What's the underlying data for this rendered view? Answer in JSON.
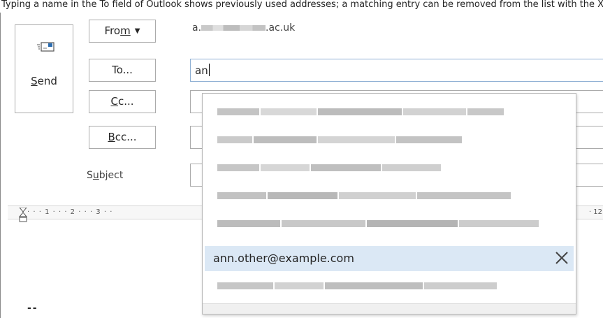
{
  "caption": "Typing a name in the To field of Outlook shows previously used addresses; a matching entry can be removed from the list with the X that appears.",
  "send_button": {
    "label_underlined": "S",
    "label_rest": "end",
    "icon": "envelope-send-icon"
  },
  "from_button": {
    "label_pre": "Fro",
    "label_underlined": "m",
    "caret_icon": "caret-down-icon"
  },
  "to_button": {
    "label": "To..."
  },
  "cc_button": {
    "label_underlined": "C",
    "label_rest": "c..."
  },
  "bcc_button": {
    "label_underlined": "B",
    "label_rest": "cc..."
  },
  "from_account": {
    "prefix": "a.",
    "suffix": ".ac.uk"
  },
  "to_field": {
    "value": "an"
  },
  "subject": {
    "label_pre": "S",
    "label_underlined": "u",
    "label_rest": "bject"
  },
  "ruler": {
    "ticks": "· · · 1 · · · 2 · · · 3 · ·",
    "right_tick": "· 12"
  },
  "body": {
    "signature": "--"
  },
  "autocomplete": {
    "visible_entry": "ann.other@example.com",
    "delete_icon": "close-x-icon",
    "entries": [
      {
        "blurred": true
      },
      {
        "blurred": true
      },
      {
        "blurred": true
      },
      {
        "blurred": true
      },
      {
        "blurred": true
      },
      {
        "blurred": false,
        "text": "ann.other@example.com",
        "highlighted": true
      },
      {
        "blurred": true
      }
    ]
  },
  "colors": {
    "highlight": "#dbe8f5",
    "border": "#ababab",
    "focus_border": "#8fb0d4"
  }
}
